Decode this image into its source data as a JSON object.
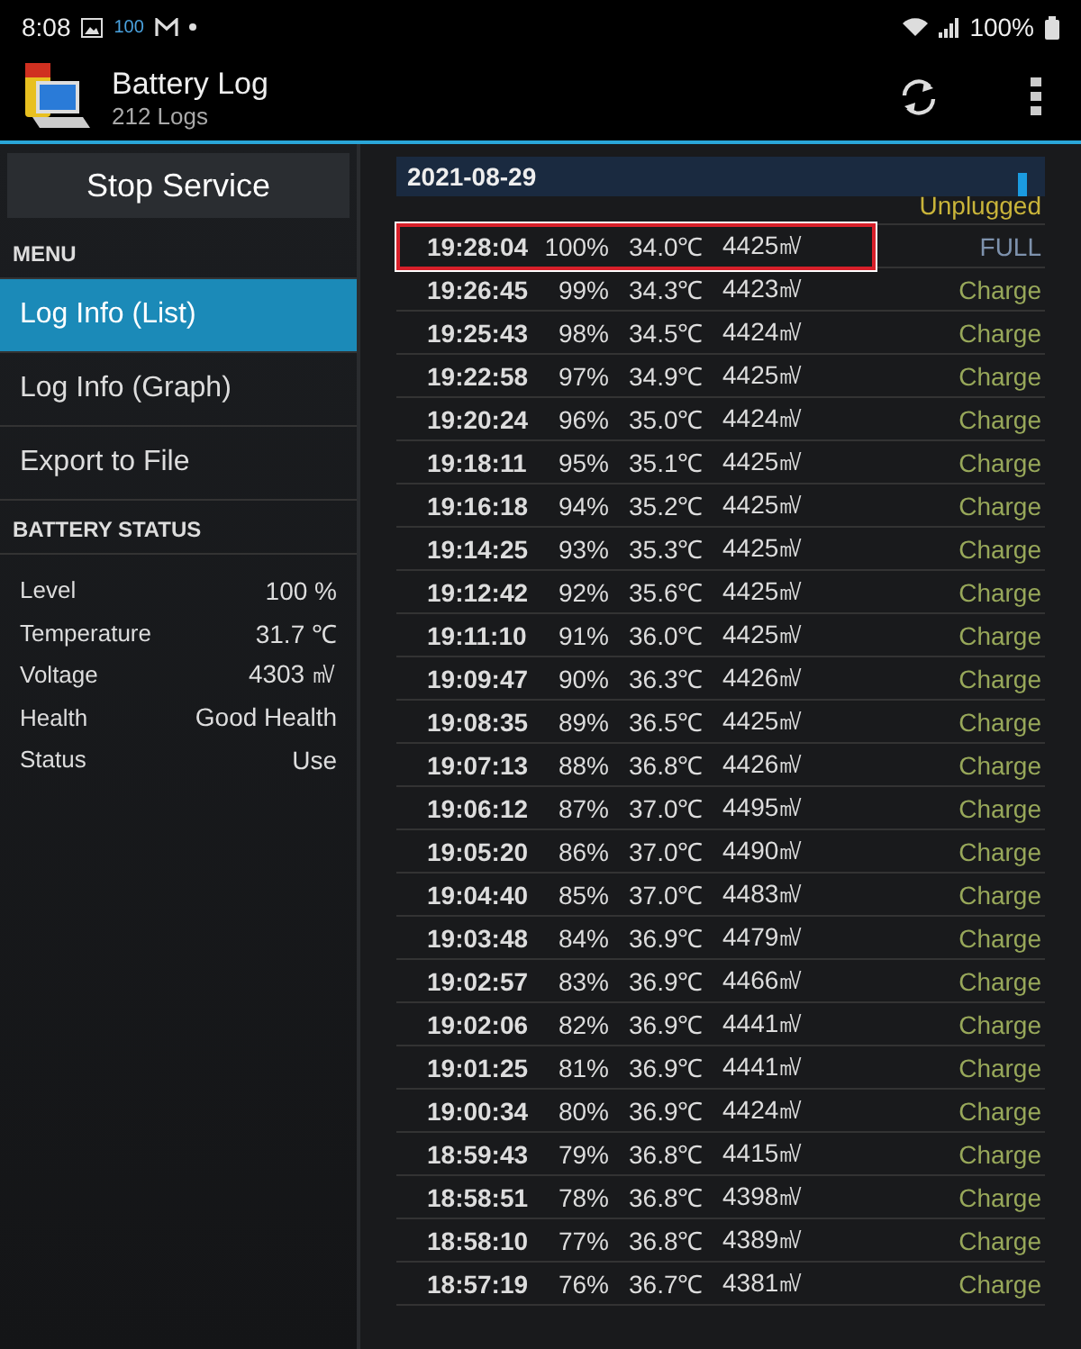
{
  "status_bar": {
    "time": "8:08",
    "badge": "100",
    "battery": "100%"
  },
  "app_bar": {
    "title": "Battery Log",
    "subtitle": "212 Logs"
  },
  "sidebar": {
    "button": "Stop Service",
    "menu_heading": "MENU",
    "menu_items": [
      {
        "label": "Log Info (List)",
        "selected": true
      },
      {
        "label": "Log Info (Graph)",
        "selected": false
      },
      {
        "label": "Export to File",
        "selected": false
      }
    ],
    "status_heading": "BATTERY STATUS",
    "status": [
      {
        "label": "Level",
        "value": "100 %"
      },
      {
        "label": "Temperature",
        "value": "31.7 ℃"
      },
      {
        "label": "Voltage",
        "value": "4303 ㎷"
      },
      {
        "label": "Health",
        "value": "Good Health"
      },
      {
        "label": "Status",
        "value": "Use"
      }
    ]
  },
  "log": {
    "date": "2021-08-29",
    "rows": [
      {
        "status": "Unplugged",
        "kind": "unplugged",
        "highlighted": false
      },
      {
        "time": "19:28:04",
        "level": "100%",
        "temp": "34.0℃",
        "voltage": "4425㎷",
        "status": "FULL",
        "kind": "full",
        "highlighted": true
      },
      {
        "time": "19:26:45",
        "level": "99%",
        "temp": "34.3℃",
        "voltage": "4423㎷",
        "status": "Charge",
        "kind": "charge",
        "highlighted": false
      },
      {
        "time": "19:25:43",
        "level": "98%",
        "temp": "34.5℃",
        "voltage": "4424㎷",
        "status": "Charge",
        "kind": "charge",
        "highlighted": false
      },
      {
        "time": "19:22:58",
        "level": "97%",
        "temp": "34.9℃",
        "voltage": "4425㎷",
        "status": "Charge",
        "kind": "charge",
        "highlighted": false
      },
      {
        "time": "19:20:24",
        "level": "96%",
        "temp": "35.0℃",
        "voltage": "4424㎷",
        "status": "Charge",
        "kind": "charge",
        "highlighted": false
      },
      {
        "time": "19:18:11",
        "level": "95%",
        "temp": "35.1℃",
        "voltage": "4425㎷",
        "status": "Charge",
        "kind": "charge",
        "highlighted": false
      },
      {
        "time": "19:16:18",
        "level": "94%",
        "temp": "35.2℃",
        "voltage": "4425㎷",
        "status": "Charge",
        "kind": "charge",
        "highlighted": false
      },
      {
        "time": "19:14:25",
        "level": "93%",
        "temp": "35.3℃",
        "voltage": "4425㎷",
        "status": "Charge",
        "kind": "charge",
        "highlighted": false
      },
      {
        "time": "19:12:42",
        "level": "92%",
        "temp": "35.6℃",
        "voltage": "4425㎷",
        "status": "Charge",
        "kind": "charge",
        "highlighted": false
      },
      {
        "time": "19:11:10",
        "level": "91%",
        "temp": "36.0℃",
        "voltage": "4425㎷",
        "status": "Charge",
        "kind": "charge",
        "highlighted": false
      },
      {
        "time": "19:09:47",
        "level": "90%",
        "temp": "36.3℃",
        "voltage": "4426㎷",
        "status": "Charge",
        "kind": "charge",
        "highlighted": false
      },
      {
        "time": "19:08:35",
        "level": "89%",
        "temp": "36.5℃",
        "voltage": "4425㎷",
        "status": "Charge",
        "kind": "charge",
        "highlighted": false
      },
      {
        "time": "19:07:13",
        "level": "88%",
        "temp": "36.8℃",
        "voltage": "4426㎷",
        "status": "Charge",
        "kind": "charge",
        "highlighted": false
      },
      {
        "time": "19:06:12",
        "level": "87%",
        "temp": "37.0℃",
        "voltage": "4495㎷",
        "status": "Charge",
        "kind": "charge",
        "highlighted": false
      },
      {
        "time": "19:05:20",
        "level": "86%",
        "temp": "37.0℃",
        "voltage": "4490㎷",
        "status": "Charge",
        "kind": "charge",
        "highlighted": false
      },
      {
        "time": "19:04:40",
        "level": "85%",
        "temp": "37.0℃",
        "voltage": "4483㎷",
        "status": "Charge",
        "kind": "charge",
        "highlighted": false
      },
      {
        "time": "19:03:48",
        "level": "84%",
        "temp": "36.9℃",
        "voltage": "4479㎷",
        "status": "Charge",
        "kind": "charge",
        "highlighted": false
      },
      {
        "time": "19:02:57",
        "level": "83%",
        "temp": "36.9℃",
        "voltage": "4466㎷",
        "status": "Charge",
        "kind": "charge",
        "highlighted": false
      },
      {
        "time": "19:02:06",
        "level": "82%",
        "temp": "36.9℃",
        "voltage": "4441㎷",
        "status": "Charge",
        "kind": "charge",
        "highlighted": false
      },
      {
        "time": "19:01:25",
        "level": "81%",
        "temp": "36.9℃",
        "voltage": "4441㎷",
        "status": "Charge",
        "kind": "charge",
        "highlighted": false
      },
      {
        "time": "19:00:34",
        "level": "80%",
        "temp": "36.9℃",
        "voltage": "4424㎷",
        "status": "Charge",
        "kind": "charge",
        "highlighted": false
      },
      {
        "time": "18:59:43",
        "level": "79%",
        "temp": "36.8℃",
        "voltage": "4415㎷",
        "status": "Charge",
        "kind": "charge",
        "highlighted": false
      },
      {
        "time": "18:58:51",
        "level": "78%",
        "temp": "36.8℃",
        "voltage": "4398㎷",
        "status": "Charge",
        "kind": "charge",
        "highlighted": false
      },
      {
        "time": "18:58:10",
        "level": "77%",
        "temp": "36.8℃",
        "voltage": "4389㎷",
        "status": "Charge",
        "kind": "charge",
        "highlighted": false
      },
      {
        "time": "18:57:19",
        "level": "76%",
        "temp": "36.7℃",
        "voltage": "4381㎷",
        "status": "Charge",
        "kind": "charge",
        "highlighted": false
      }
    ]
  }
}
